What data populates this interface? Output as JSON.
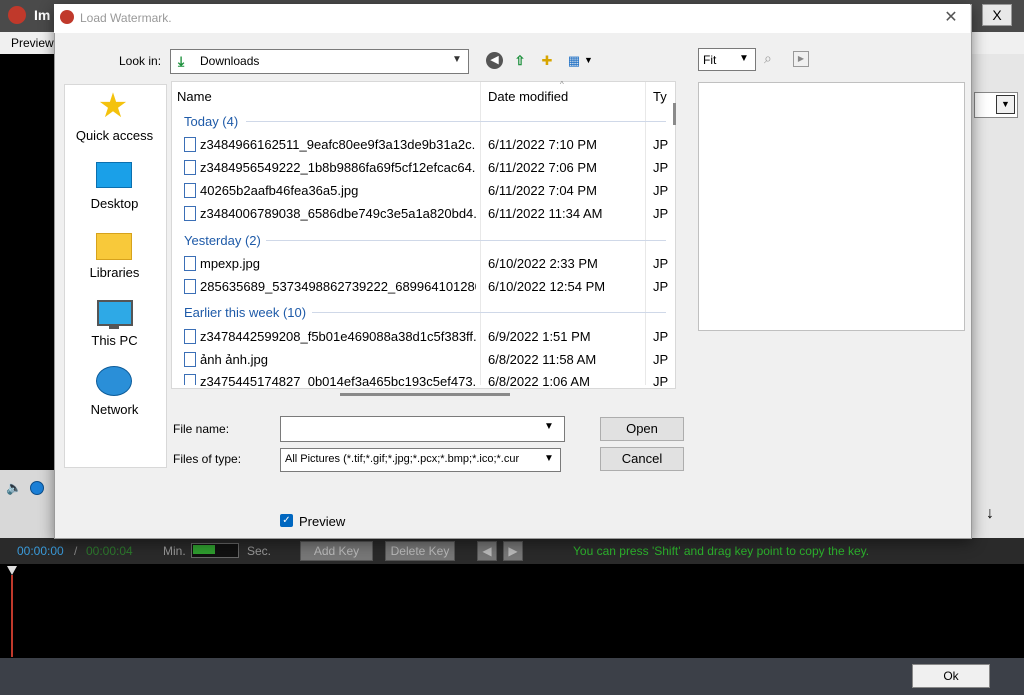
{
  "app": {
    "title": "Im",
    "menu_preview": "Preview",
    "close_label": "X",
    "timeline": {
      "current": "00:00:00",
      "separator": "/",
      "total": "00:00:04",
      "min_label": "Min.",
      "sec_label": "Sec.",
      "add_key": "Add Key",
      "delete_key": "Delete Key",
      "hint": "You can press 'Shift' and drag key point to copy the key."
    },
    "ok_label": "Ok",
    "download_icon": "↓"
  },
  "dialog": {
    "title": "Load Watermark.",
    "close_icon": "✕",
    "look_in_label": "Look in:",
    "look_in_value": "Downloads",
    "places": [
      {
        "label": "Quick access",
        "icon": "star-icon"
      },
      {
        "label": "Desktop",
        "icon": "desktop-icon"
      },
      {
        "label": "Libraries",
        "icon": "folder-icon"
      },
      {
        "label": "This PC",
        "icon": "monitor-icon"
      },
      {
        "label": "Network",
        "icon": "network-icon"
      }
    ],
    "columns": {
      "name": "Name",
      "date": "Date modified",
      "type": "Ty"
    },
    "groups": [
      {
        "label": "Today (4)",
        "files": [
          {
            "name": "z3484966162511_9eafc80ee9f3a13de9b31a2c...",
            "date": "6/11/2022 7:10 PM",
            "type": "JP"
          },
          {
            "name": "z3484956549222_1b8b9886fa69f5cf12efcac64...",
            "date": "6/11/2022 7:06 PM",
            "type": "JP"
          },
          {
            "name": "40265b2aafb46fea36a5.jpg",
            "date": "6/11/2022 7:04 PM",
            "type": "JP"
          },
          {
            "name": "z3484006789038_6586dbe749c3e5a1a820bd4...",
            "date": "6/11/2022 11:34 AM",
            "type": "JP"
          }
        ]
      },
      {
        "label": "Yesterday (2)",
        "files": [
          {
            "name": "mpexp.jpg",
            "date": "6/10/2022 2:33 PM",
            "type": "JP"
          },
          {
            "name": "285635689_5373498862739222_689964101280...",
            "date": "6/10/2022 12:54 PM",
            "type": "JP"
          }
        ]
      },
      {
        "label": "Earlier this week (10)",
        "files": [
          {
            "name": "z3478442599208_f5b01e469088a38d1c5f383ff...",
            "date": "6/9/2022 1:51 PM",
            "type": "JP"
          },
          {
            "name": "ảnh ảnh.jpg",
            "date": "6/8/2022 11:58 AM",
            "type": "JP"
          },
          {
            "name": "z3475445174827_0b014ef3a465bc193c5ef473...",
            "date": "6/8/2022 1:06 AM",
            "type": "JP"
          }
        ]
      }
    ],
    "file_name_label": "File name:",
    "file_name_value": "",
    "file_type_label": "Files of type:",
    "file_type_value": "All Pictures (*.tif;*.gif;*.jpg;*.pcx;*.bmp;*.ico;*.cur",
    "open_label": "Open",
    "cancel_label": "Cancel",
    "preview_label": "Preview",
    "preview_checked": true,
    "zoom_value": "Fit"
  }
}
